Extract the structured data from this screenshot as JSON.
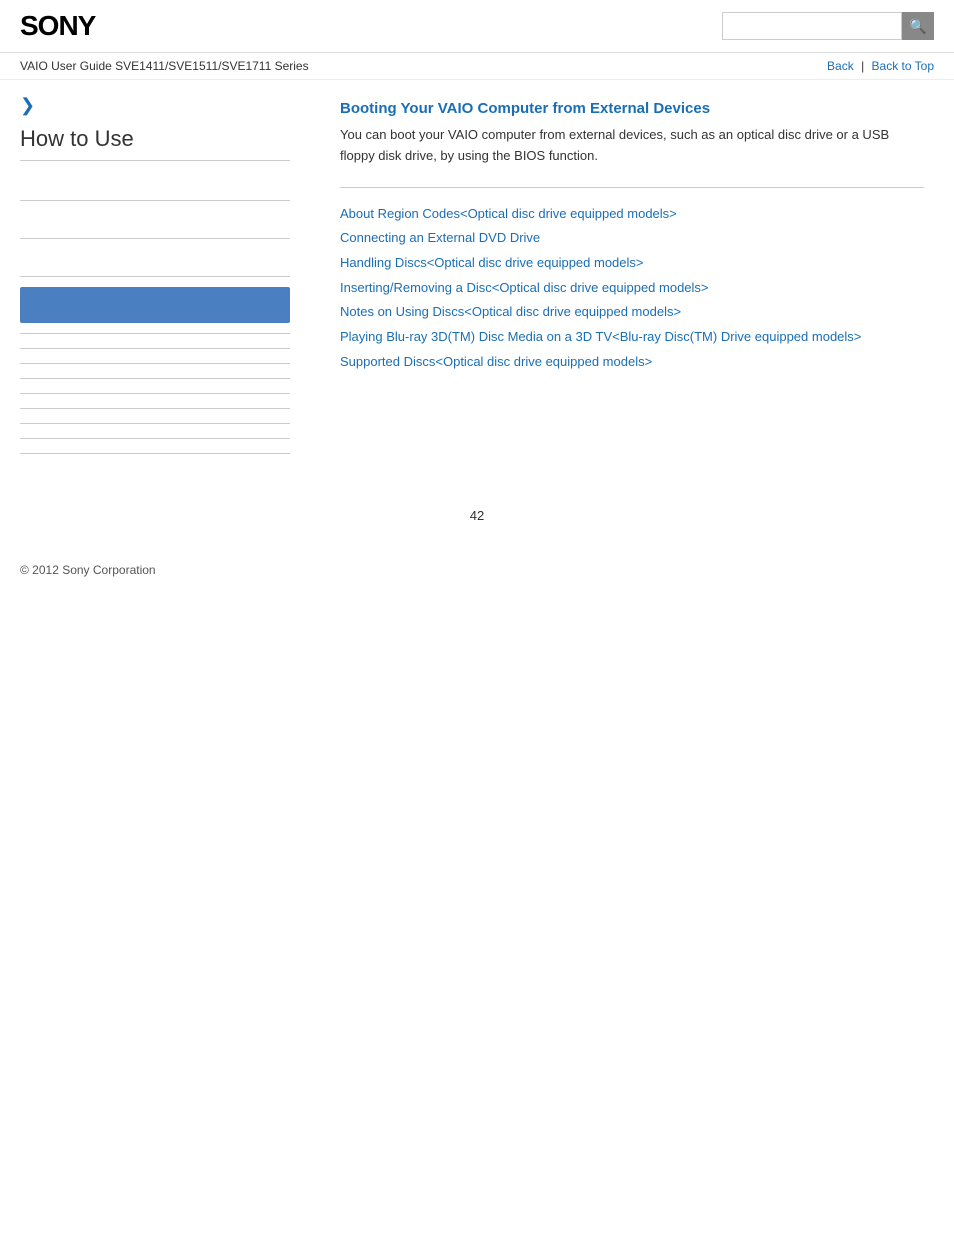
{
  "header": {
    "logo": "SONY",
    "search_placeholder": ""
  },
  "breadcrumb": {
    "guide_title": "VAIO User Guide SVE1411/SVE1511/SVE1711 Series",
    "back_label": "Back",
    "back_to_top_label": "Back to Top"
  },
  "sidebar": {
    "expand_icon": "❯",
    "title": "How to Use"
  },
  "content": {
    "main_link_title": "Booting Your VAIO Computer from External Devices",
    "main_description": "You can boot your VAIO computer from external devices, such as an optical disc drive or a USB floppy disk drive, by using the BIOS function.",
    "sub_links": [
      "About Region Codes<Optical disc drive equipped models>",
      "Connecting an External DVD Drive",
      "Handling Discs<Optical disc drive equipped models>",
      "Inserting/Removing a Disc<Optical disc drive equipped models>",
      "Notes on Using Discs<Optical disc drive equipped models>",
      "Playing Blu-ray 3D(TM) Disc Media on a 3D TV<Blu-ray Disc(TM) Drive equipped models>",
      "Supported Discs<Optical disc drive equipped models>"
    ]
  },
  "footer": {
    "copyright": "© 2012 Sony Corporation"
  },
  "page_number": "42",
  "icons": {
    "search": "🔍"
  }
}
